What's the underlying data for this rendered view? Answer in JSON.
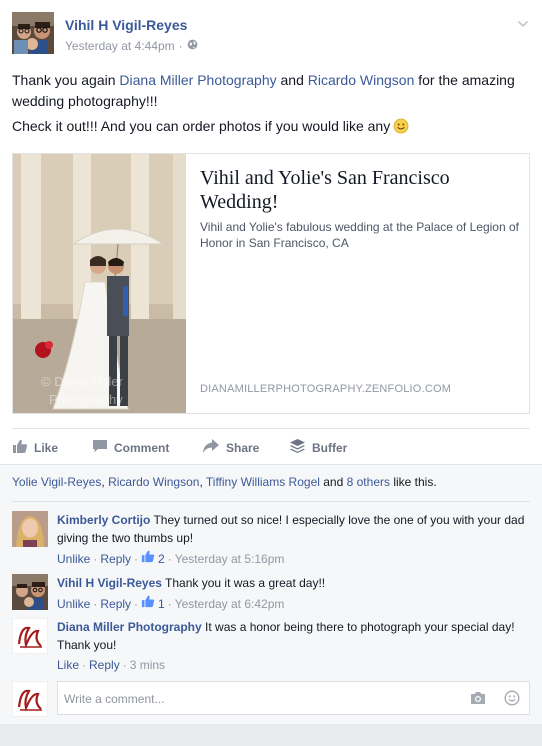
{
  "post": {
    "author": "Vihil H Vigil-Reyes",
    "timestamp": "Yesterday at 4:44pm",
    "separator": "·",
    "audience_icon": "globe-icon",
    "menu_icon": "chevron-down-icon",
    "text": {
      "line1_pre": "Thank you again ",
      "mention1": "Diana Miller Photography",
      "line1_mid": " and ",
      "mention2": "Ricardo Wingson",
      "line1_post": " for the amazing wedding photography!!!",
      "line2": "Check it out!!! And you can order photos if you would like any"
    },
    "shared_link": {
      "title": "Vihil and Yolie's San Francisco Wedding!",
      "description": "Vihil and Yolie's fabulous wedding at the Palace of Legion of Honor in San Francisco, CA",
      "domain": "DIANAMILLERPHOTOGRAPHY.ZENFOLIO.COM",
      "image_watermark": "© Diana Miller Photography"
    },
    "actions": {
      "like": "Like",
      "comment": "Comment",
      "share": "Share",
      "buffer": "Buffer"
    }
  },
  "likes_summary": {
    "name1": "Yolie Vigil-Reyes",
    "sep1": ", ",
    "name2": "Ricardo Wingson",
    "sep2": ", ",
    "name3": "Tiffiny Williams Rogel",
    "and": " and ",
    "others": "8 others",
    "suffix": " like this."
  },
  "comments": [
    {
      "author": "Kimberly Cortijo",
      "text": " They turned out so nice! I especially love the one of you with your dad giving the two thumbs up!",
      "unlike": "Unlike",
      "reply": "Reply",
      "likes": "2",
      "time": "Yesterday at 5:16pm"
    },
    {
      "author": "Vihil H Vigil-Reyes",
      "text": " Thank you it was a great day!!",
      "unlike": "Unlike",
      "reply": "Reply",
      "likes": "1",
      "time": "Yesterday at 6:42pm"
    },
    {
      "author": "Diana Miller Photography",
      "text": " It was a honor being there to photograph your special day! Thank you!",
      "like": "Like",
      "reply": "Reply",
      "time": "3 mins"
    }
  ],
  "reply_box": {
    "placeholder": "Write a comment...",
    "camera_icon": "camera-icon",
    "emoji_icon": "smiley-icon"
  },
  "colors": {
    "link_blue": "#3b5998",
    "meta_gray": "#9197a3",
    "ufi_background": "#f6f7f8"
  },
  "sep": "·"
}
